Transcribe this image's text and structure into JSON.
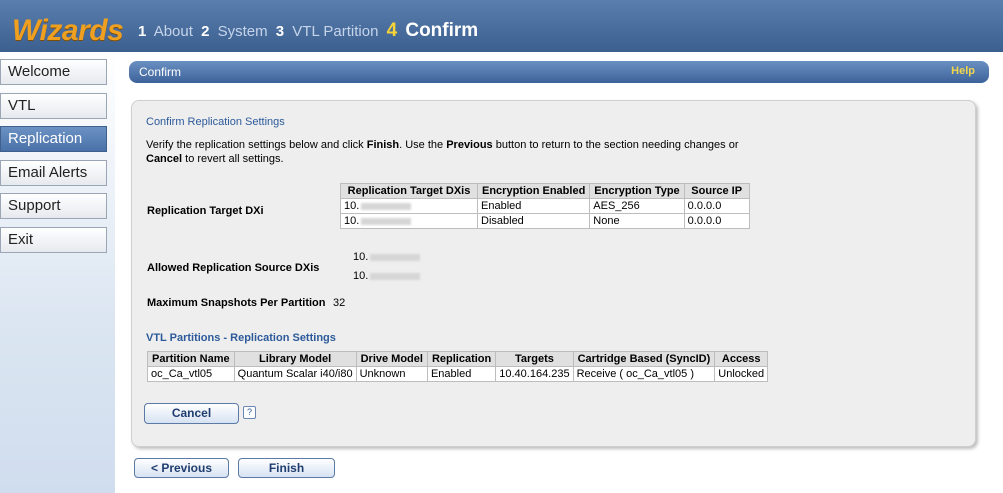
{
  "app": {
    "logo": "Wizards"
  },
  "steps": [
    {
      "num": "1",
      "label": "About"
    },
    {
      "num": "2",
      "label": "System"
    },
    {
      "num": "3",
      "label": "VTL Partition"
    },
    {
      "num": "4",
      "label": "Confirm"
    }
  ],
  "sidebar": {
    "items": [
      {
        "label": "Welcome"
      },
      {
        "label": "VTL"
      },
      {
        "label": "Replication"
      },
      {
        "label": "Email Alerts"
      },
      {
        "label": "Support"
      },
      {
        "label": "Exit"
      }
    ]
  },
  "header": {
    "title": "Confirm",
    "help": "Help"
  },
  "confirm": {
    "section_title": "Confirm Replication Settings",
    "instr_1": "Verify the replication settings below and click ",
    "instr_finish": "Finish",
    "instr_2": ". Use the ",
    "instr_previous": "Previous",
    "instr_3": " button to return to the section needing changes or",
    "instr_cancel": "Cancel",
    "instr_4": " to revert all settings."
  },
  "target": {
    "label": "Replication Target DXi",
    "headers": [
      "Replication Target DXis",
      "Encryption Enabled",
      "Encryption Type",
      "Source IP"
    ],
    "rows": [
      {
        "dxi": "10.",
        "enabled": "Enabled",
        "type": "AES_256",
        "source_ip": "0.0.0.0"
      },
      {
        "dxi": "10.",
        "enabled": "Disabled",
        "type": "None",
        "source_ip": "0.0.0.0"
      }
    ]
  },
  "sources": {
    "label": "Allowed Replication Source DXis",
    "ips": [
      "10.",
      "10."
    ]
  },
  "snapshots": {
    "label": "Maximum Snapshots Per Partition",
    "value": "32"
  },
  "vtl": {
    "section_title": "VTL Partitions - Replication Settings",
    "headers": [
      "Partition Name",
      "Library Model",
      "Drive Model",
      "Replication",
      "Targets",
      "Cartridge Based (SyncID)",
      "Access"
    ],
    "rows": [
      {
        "partition": "oc_Ca_vtl05",
        "library": "Quantum Scalar i40/i80",
        "drive": "Unknown",
        "replication": "Enabled",
        "targets": "10.40.164.235",
        "cartridge": "Receive ( oc_Ca_vtl05 )",
        "access": "Unlocked"
      }
    ]
  },
  "buttons": {
    "cancel": "Cancel",
    "help_mark": "?",
    "previous": "< Previous",
    "finish": "Finish"
  }
}
